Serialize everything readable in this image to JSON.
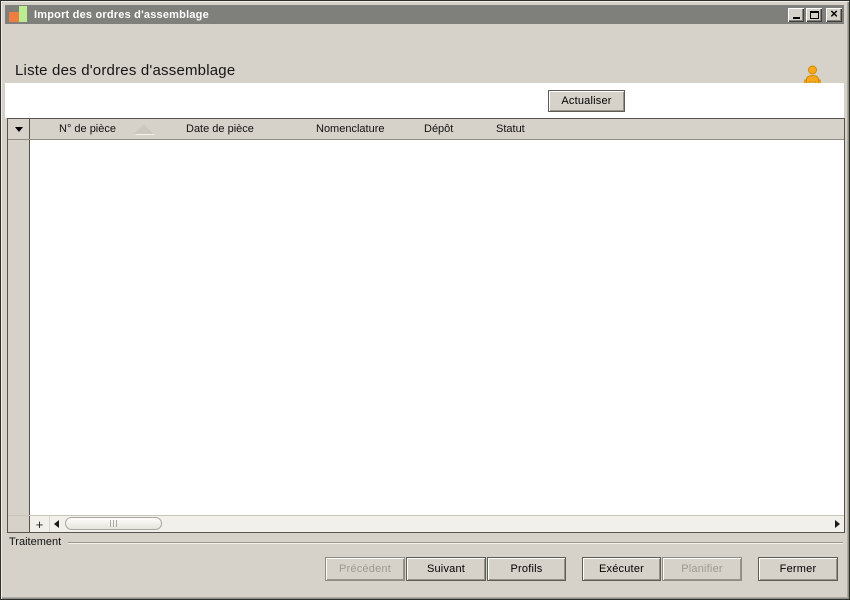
{
  "titlebar": {
    "title": "Import des ordres d'assemblage"
  },
  "icons": {
    "close_glyph": "×",
    "app_icon": "orange-green-bars",
    "user_icon": "orange-person"
  },
  "page": {
    "heading": "Liste des d'ordres d'assemblage"
  },
  "toolbar": {
    "refresh": "Actualiser"
  },
  "grid": {
    "columns": [
      {
        "label": "N° de pièce",
        "sorted": "asc"
      },
      {
        "label": "Date de pièce",
        "sorted": ""
      },
      {
        "label": "Nomenclature",
        "sorted": ""
      },
      {
        "label": "Dépôt",
        "sorted": ""
      },
      {
        "label": "Statut",
        "sorted": ""
      }
    ],
    "rows": [],
    "add_label": "+"
  },
  "statusbar": {
    "group_label": "Traitement"
  },
  "actions": {
    "previous": {
      "label": "Précédent",
      "enabled": false
    },
    "next": {
      "label": "Suivant",
      "enabled": true
    },
    "profiles": {
      "label": "Profils",
      "enabled": true
    },
    "execute": {
      "label": "Exécuter",
      "enabled": true
    },
    "schedule": {
      "label": "Planifier",
      "enabled": false
    },
    "close": {
      "label": "Fermer",
      "enabled": true
    }
  },
  "colors": {
    "window_bg": "#d6d2ca",
    "titlebar_bg": "#7f7f7b",
    "accent_orange": "#f7a81b",
    "accent_green": "#bcec90",
    "grid_body_bg": "#ffffff"
  }
}
